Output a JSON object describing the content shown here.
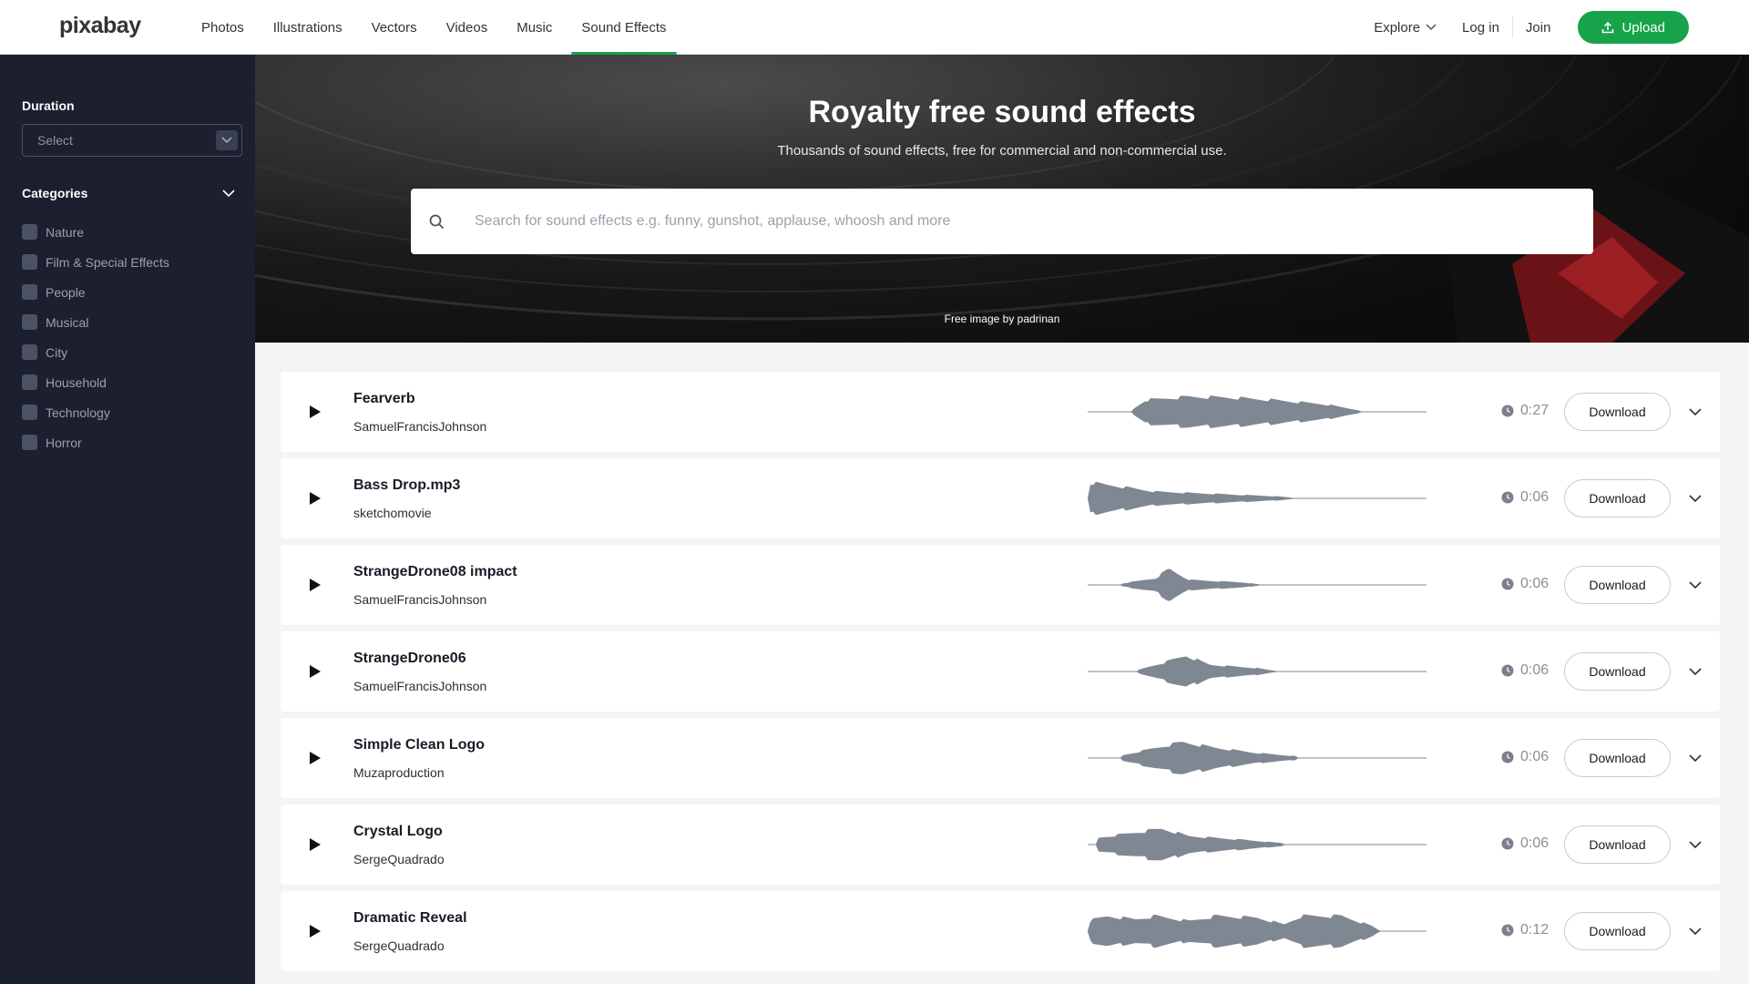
{
  "header": {
    "logo": "pixabay",
    "nav": [
      "Photos",
      "Illustrations",
      "Vectors",
      "Videos",
      "Music",
      "Sound Effects"
    ],
    "active_nav": "Sound Effects",
    "explore": "Explore",
    "login": "Log in",
    "join": "Join",
    "upload": "Upload",
    "accent_color": "#16a34a"
  },
  "sidebar": {
    "duration_title": "Duration",
    "duration_select": "Select",
    "categories_title": "Categories",
    "categories": [
      "Nature",
      "Film & Special Effects",
      "People",
      "Musical",
      "City",
      "Household",
      "Technology",
      "Horror"
    ]
  },
  "hero": {
    "title": "Royalty free sound effects",
    "subtitle": "Thousands of sound effects, free for commercial and non-commercial use.",
    "search_placeholder": "Search for sound effects e.g. funny, gunshot, applause, whoosh and more",
    "credit": "Free image by padrinan"
  },
  "tracks": [
    {
      "title": "Fearverb",
      "author": "SamuelFrancisJohnson",
      "duration": "0:27",
      "download": "Download"
    },
    {
      "title": "Bass Drop.mp3",
      "author": "sketchomovie",
      "duration": "0:06",
      "download": "Download"
    },
    {
      "title": "StrangeDrone08 impact",
      "author": "SamuelFrancisJohnson",
      "duration": "0:06",
      "download": "Download"
    },
    {
      "title": "StrangeDrone06",
      "author": "SamuelFrancisJohnson",
      "duration": "0:06",
      "download": "Download"
    },
    {
      "title": "Simple Clean Logo",
      "author": "Muzaproduction",
      "duration": "0:06",
      "download": "Download"
    },
    {
      "title": "Crystal Logo",
      "author": "SergeQuadrado",
      "duration": "0:06",
      "download": "Download"
    },
    {
      "title": "Dramatic Reveal",
      "author": "SergeQuadrado",
      "duration": "0:12",
      "download": "Download"
    }
  ]
}
